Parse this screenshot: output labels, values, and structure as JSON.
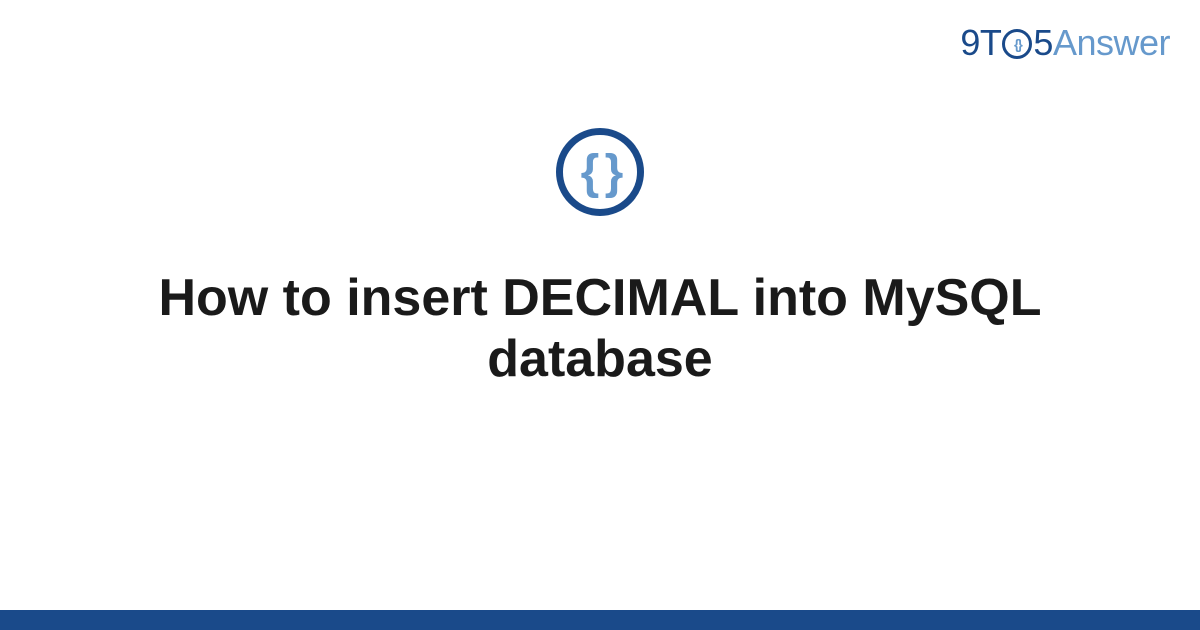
{
  "logo": {
    "part1": "9T",
    "circle_inner": "{}",
    "part2": "5",
    "part3": "Answer"
  },
  "icon": {
    "braces": "{ }"
  },
  "title": "How to insert DECIMAL into MySQL database",
  "colors": {
    "dark_blue": "#1a4a8a",
    "light_blue": "#6699cc",
    "text": "#1a1a1a"
  }
}
